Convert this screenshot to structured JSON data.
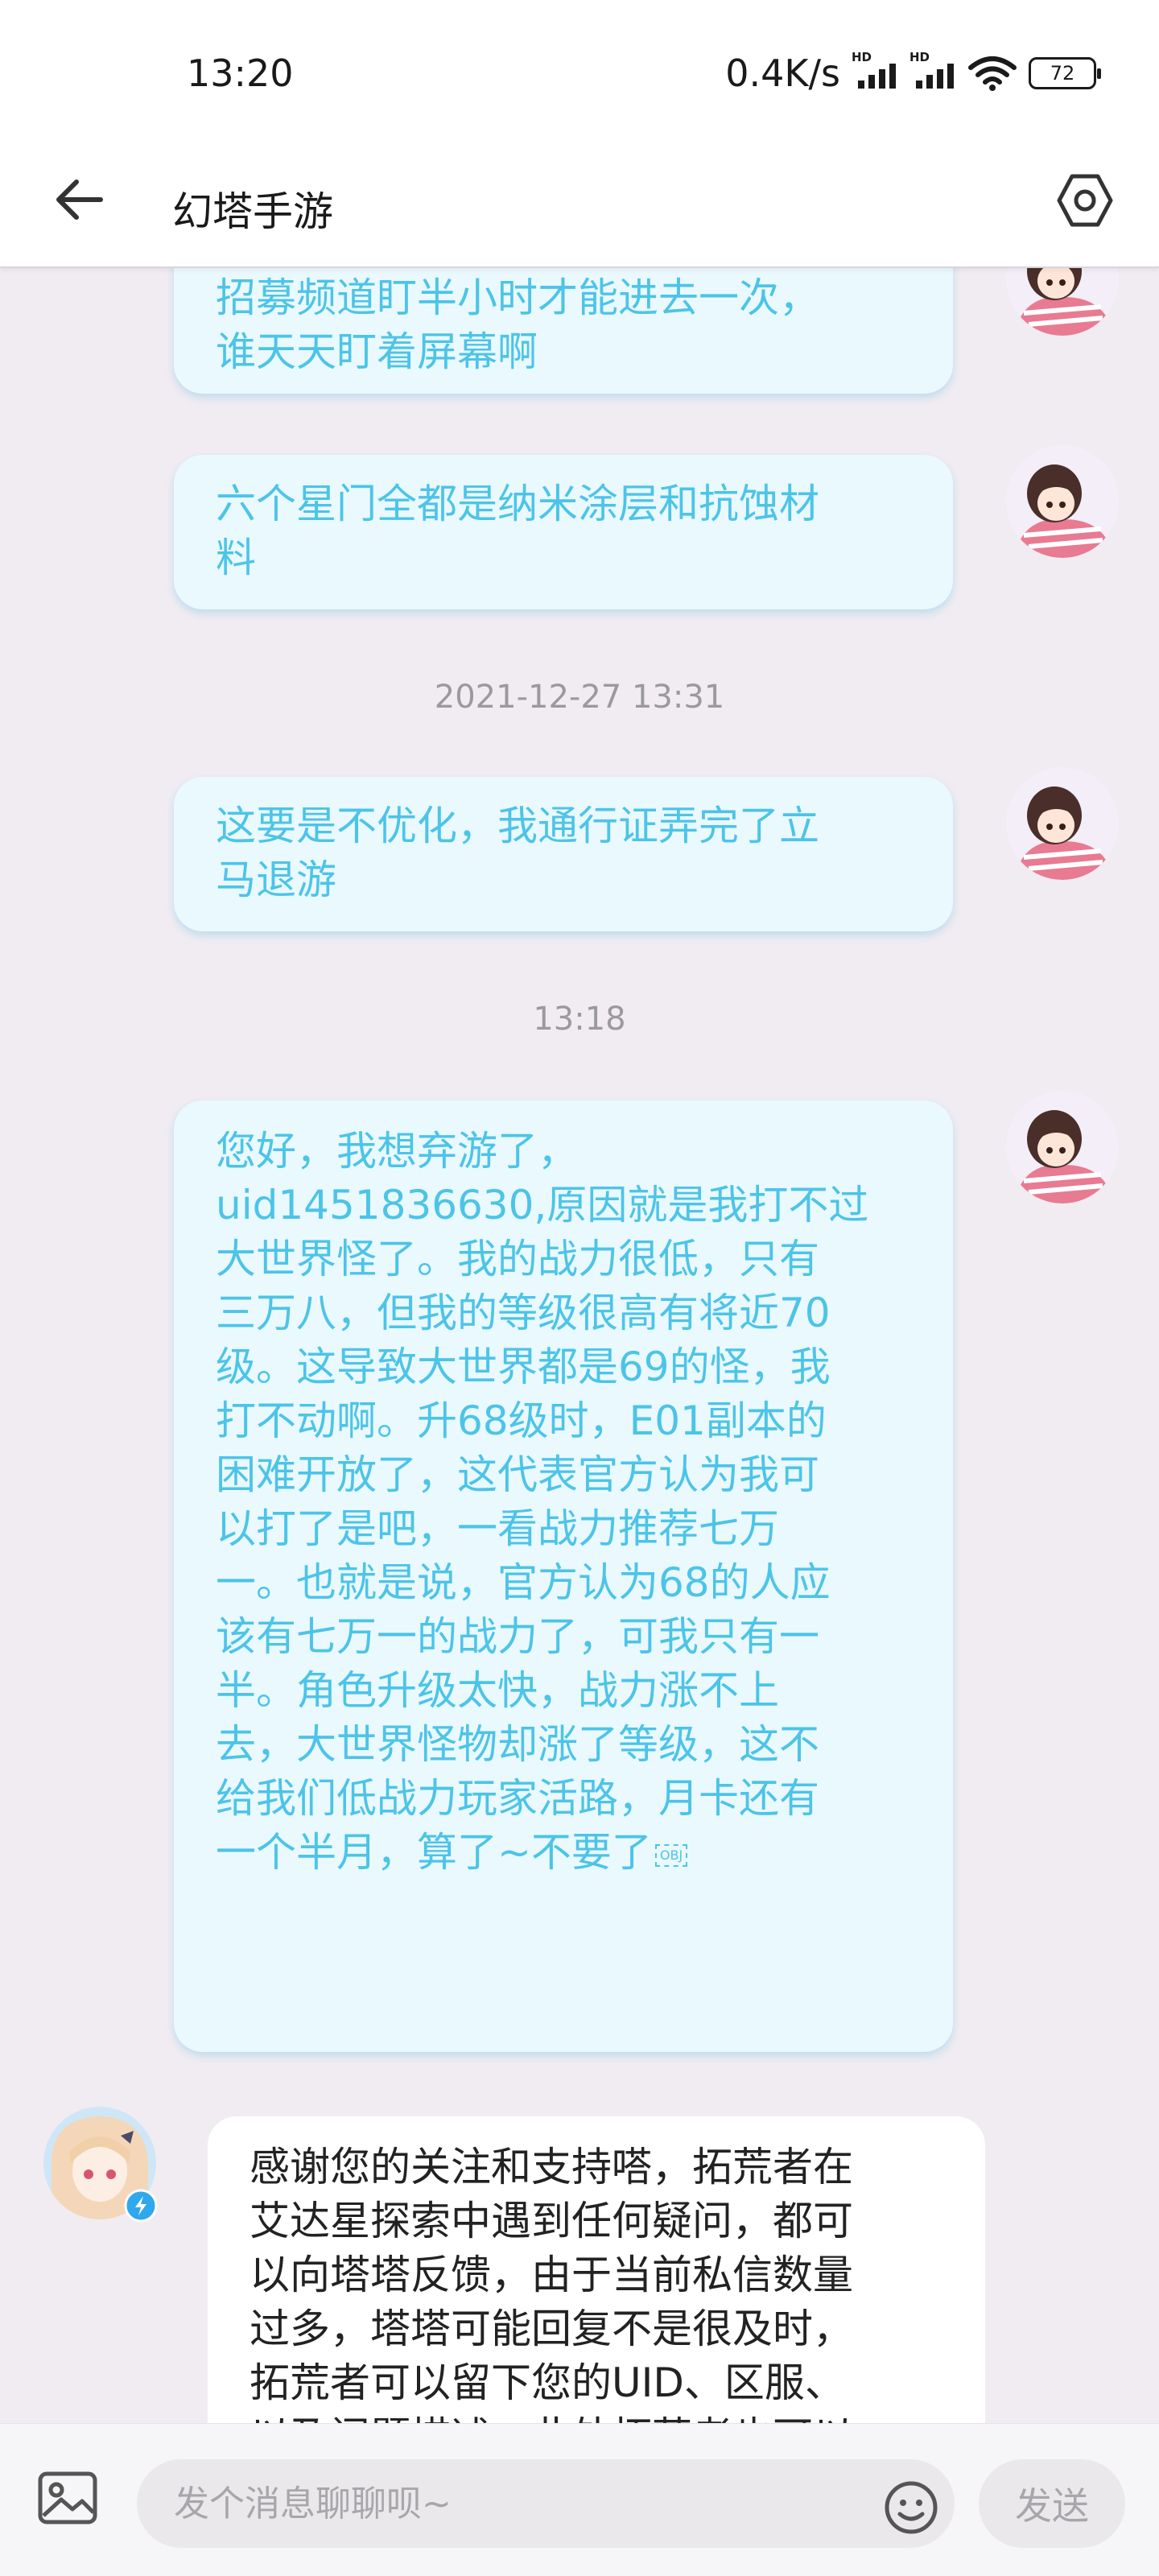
{
  "status_bar": {
    "time": "13:20",
    "net_speed": "0.4K/s",
    "signal_label": "HD",
    "battery": "72"
  },
  "header": {
    "title": "幻塔手游",
    "back_icon": "arrow-left-icon",
    "settings_icon": "settings-hexagon-icon"
  },
  "messages": [
    {
      "type": "out",
      "lines": [
        "招募频道盯半小时才能进去一次，",
        "谁天天盯着屏幕啊"
      ]
    },
    {
      "type": "out",
      "lines": [
        "六个星门全都是纳米涂层和抗蚀材",
        "料"
      ]
    },
    {
      "type": "time",
      "text": "2021-12-27 13:31"
    },
    {
      "type": "out",
      "lines": [
        "这要是不优化，我通行证弄完了立",
        "马退游"
      ]
    },
    {
      "type": "time",
      "text": "13:18"
    },
    {
      "type": "out",
      "lines": [
        "您好，我想弃游了，",
        "uid1451836630,原因就是我打不过",
        "大世界怪了。我的战力很低，只有",
        "三万八，但我的等级很高有将近70",
        "级。这导致大世界都是69的怪，我",
        "打不动啊。升68级时，E01副本的",
        "困难开放了，这代表官方认为我可",
        "以打了是吧，一看战力推荐七万",
        "一。也就是说，官方认为68的人应",
        "该有七万一的战力了，可我只有一",
        "半。角色升级太快，战力涨不上",
        "去，大世界怪物却涨了等级，这不",
        "给我们低战力玩家活路，月卡还有",
        "一个半月，算了~不要了"
      ],
      "obj_marker": "OBJ"
    },
    {
      "type": "in",
      "lines": [
        "感谢您的关注和支持嗒，拓荒者在",
        "艾达星探索中遇到任何疑问，都可",
        "以向塔塔反馈，由于当前私信数量",
        "过多，塔塔可能回复不是很及时，",
        "拓荒者可以留下您的UID、区服、",
        "以及问题描述，此外拓荒者也可以"
      ]
    }
  ],
  "input_bar": {
    "placeholder": "发个消息聊聊呗~",
    "send_label": "发送",
    "image_icon": "image-icon",
    "emoji_icon": "emoji-icon"
  },
  "colors": {
    "out_text": "#4cc4e8",
    "out_bg": "#eaf9fe",
    "in_bg": "#ffffff",
    "chat_bg": "#f1ecf2"
  }
}
